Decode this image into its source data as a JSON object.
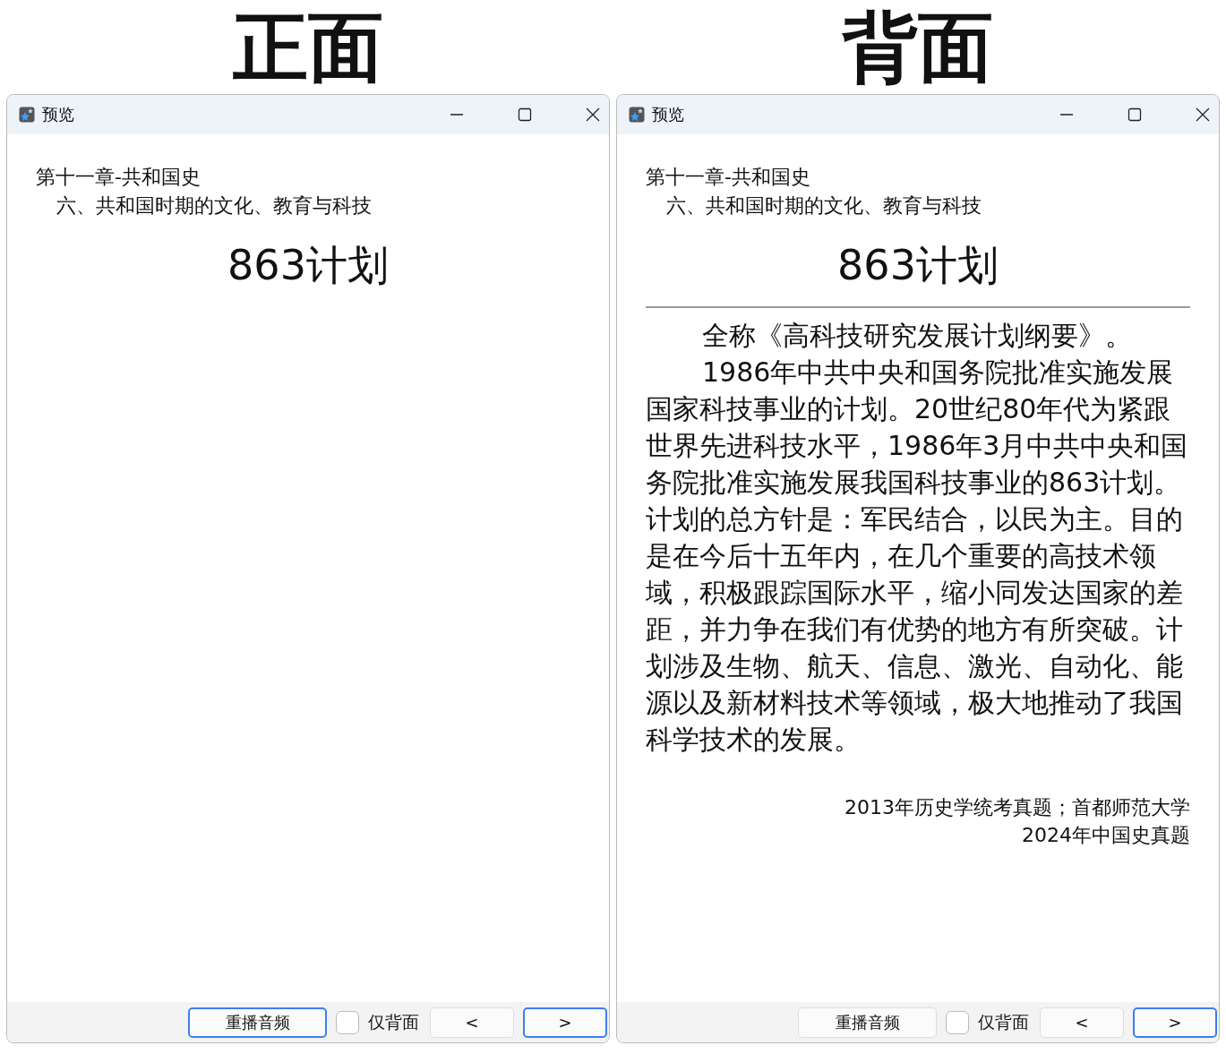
{
  "panels": [
    {
      "heading": "正面",
      "window": {
        "title": "预览"
      },
      "chapter": "第十一章-共和国史",
      "section": "六、共和国时期的文化、教育与科技",
      "card_title": "863计划",
      "controls": [
        {
          "kind": "button",
          "label": "重播音频",
          "focused": true
        },
        {
          "kind": "checkbox",
          "label": "仅背面",
          "checked": false
        },
        {
          "kind": "button",
          "label": "<",
          "focused": false
        },
        {
          "kind": "button",
          "label": ">",
          "focused": true
        }
      ]
    },
    {
      "heading": "背面",
      "window": {
        "title": "预览"
      },
      "chapter": "第十一章-共和国史",
      "section": "六、共和国时期的文化、教育与科技",
      "card_title": "863计划",
      "paragraphs": [
        "全称《高科技研究发展计划纲要》。",
        "1986年中共中央和国务院批准实施发展国家科技事业的计划。20世纪80年代为紧跟世界先进科技水平，1986年3月中共中央和国务院批准实施发展我国科技事业的863计划。计划的总方针是：军民结合，以民为主。目的是在今后十五年内，在几个重要的高技术领域，积极跟踪国际水平，缩小同发达国家的差距，并力争在我们有优势的地方有所突破。计划涉及生物、航天、信息、激光、自动化、能源以及新材料技术等领域，极大地推动了我国科学技术的发展。"
      ],
      "sources": [
        "2013年历史学统考真题；首都师范大学",
        "2024年中国史真题"
      ],
      "controls": [
        {
          "kind": "button",
          "label": "重播音频",
          "focused": false
        },
        {
          "kind": "checkbox",
          "label": "仅背面",
          "checked": false
        },
        {
          "kind": "button",
          "label": "<",
          "focused": false
        },
        {
          "kind": "button",
          "label": ">",
          "focused": true
        }
      ]
    }
  ]
}
